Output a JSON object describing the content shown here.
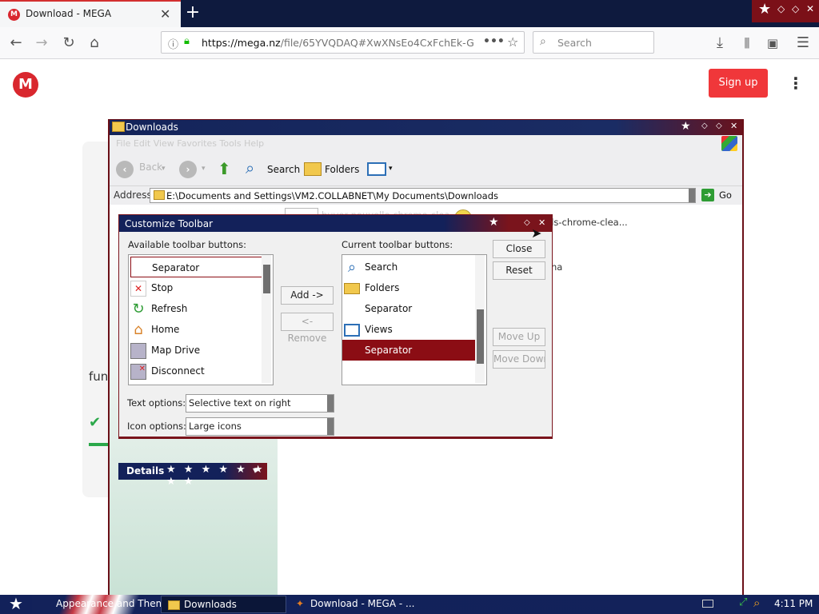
{
  "browser": {
    "tab_title": "Download - MEGA",
    "tab_favicon": "M",
    "url_host": "https://mega.nz",
    "url_path": "/file/65YVQDAQ#XwXNsEo4CxFchEk-G",
    "search_placeholder": "Search"
  },
  "mega": {
    "logo_letter": "M",
    "signup_label": "Sign up",
    "kebab": "⋮",
    "partial_text": "fun",
    "check": "✔"
  },
  "explorer": {
    "title": "Downloads",
    "menubar_faded": "File   Edit   View   Favorites   Tools   Help",
    "toolbar": {
      "back": "Back",
      "search": "Search",
      "folders": "Folders"
    },
    "address_label": "Address",
    "address_value": "E:\\Documents and Settings\\VM2.COLLABNET\\My Documents\\Downloads",
    "go_label": "Go",
    "bg_file1": "lls-chrome-clea...",
    "bg_file2": "ha",
    "bg_file3_faded": "buyer-nouvelle chrome-clea",
    "details_label": "Details",
    "details_stars": "★ ★ ★ ★ ★ ★ ★ ★",
    "details_chevron": "▾"
  },
  "customize_toolbar": {
    "title": "Customize Toolbar",
    "available_label": "Available toolbar buttons:",
    "current_label": "Current toolbar buttons:",
    "available_items": [
      {
        "label": "Separator",
        "icon": "separator"
      },
      {
        "label": "Stop",
        "icon": "stop-icon"
      },
      {
        "label": "Refresh",
        "icon": "refresh-icon"
      },
      {
        "label": "Home",
        "icon": "home-icon"
      },
      {
        "label": "Map Drive",
        "icon": "map-drive-icon"
      },
      {
        "label": "Disconnect",
        "icon": "disconnect-icon"
      }
    ],
    "current_items": [
      {
        "label": "Search",
        "icon": "search-icon"
      },
      {
        "label": "Folders",
        "icon": "folder-icon"
      },
      {
        "label": "Separator",
        "icon": "separator"
      },
      {
        "label": "Views",
        "icon": "views-icon"
      },
      {
        "label": "Separator",
        "icon": "separator",
        "selected": true
      }
    ],
    "add_label": "Add ->",
    "remove_label": "<- Remove",
    "close_label": "Close",
    "reset_label": "Reset",
    "move_up_label": "Move Up",
    "move_down_label": "Move Down",
    "text_options_label": "Text options:",
    "text_options_value": "Selective text on right",
    "icon_options_label": "Icon options:",
    "icon_options_value": "Large icons",
    "selection_color": "#8b0d14"
  },
  "taskbar": {
    "task1": "Appearance and Them",
    "task2": "Downloads",
    "task3": "Download - MEGA - ...",
    "clock": "4:11 PM"
  }
}
